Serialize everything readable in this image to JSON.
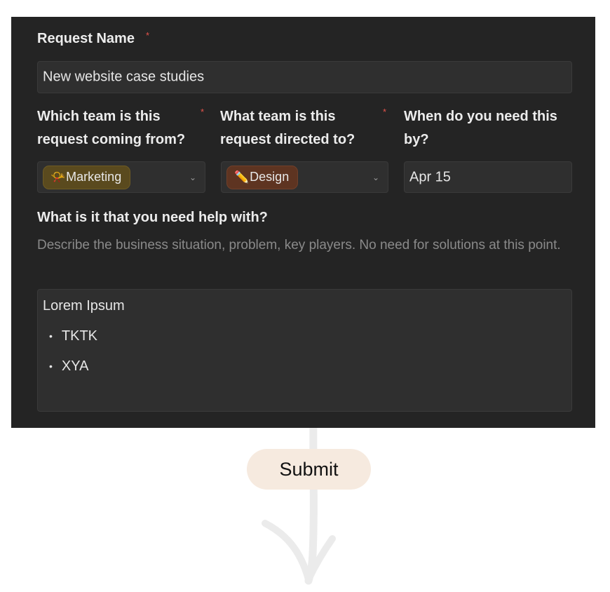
{
  "form": {
    "request_name": {
      "label": "Request Name",
      "required_mark": "*",
      "value": "New website case studies"
    },
    "from_team": {
      "label_line1": "Which team is this",
      "label_line2": "request coming from?",
      "required_mark": "*",
      "selected": {
        "icon": "megaphone-icon",
        "emoji": "📯",
        "label": "Marketing"
      }
    },
    "to_team": {
      "label_line1": "What team is this",
      "label_line2": "request directed to?",
      "required_mark": "*",
      "selected": {
        "icon": "pencil-icon",
        "emoji": "✏️",
        "label": "Design"
      }
    },
    "due_date": {
      "label_line1": "When do you need this",
      "label_line2": "by?",
      "value": "Apr 15"
    },
    "help": {
      "label": "What is it that you need help with?",
      "description": "Describe the business situation, problem, key players. No need for solutions at this point.",
      "content": {
        "paragraph": "Lorem Ipsum",
        "bullets": [
          "TKTK",
          "XYA"
        ]
      }
    }
  },
  "submit_label": "Submit",
  "colors": {
    "panel_bg": "#242424",
    "field_bg": "#2f2f2f",
    "required": "#e5534b",
    "marketing_tag": "#5a4a1e",
    "design_tag": "#5e3421",
    "submit_bg": "#f6eadf"
  }
}
